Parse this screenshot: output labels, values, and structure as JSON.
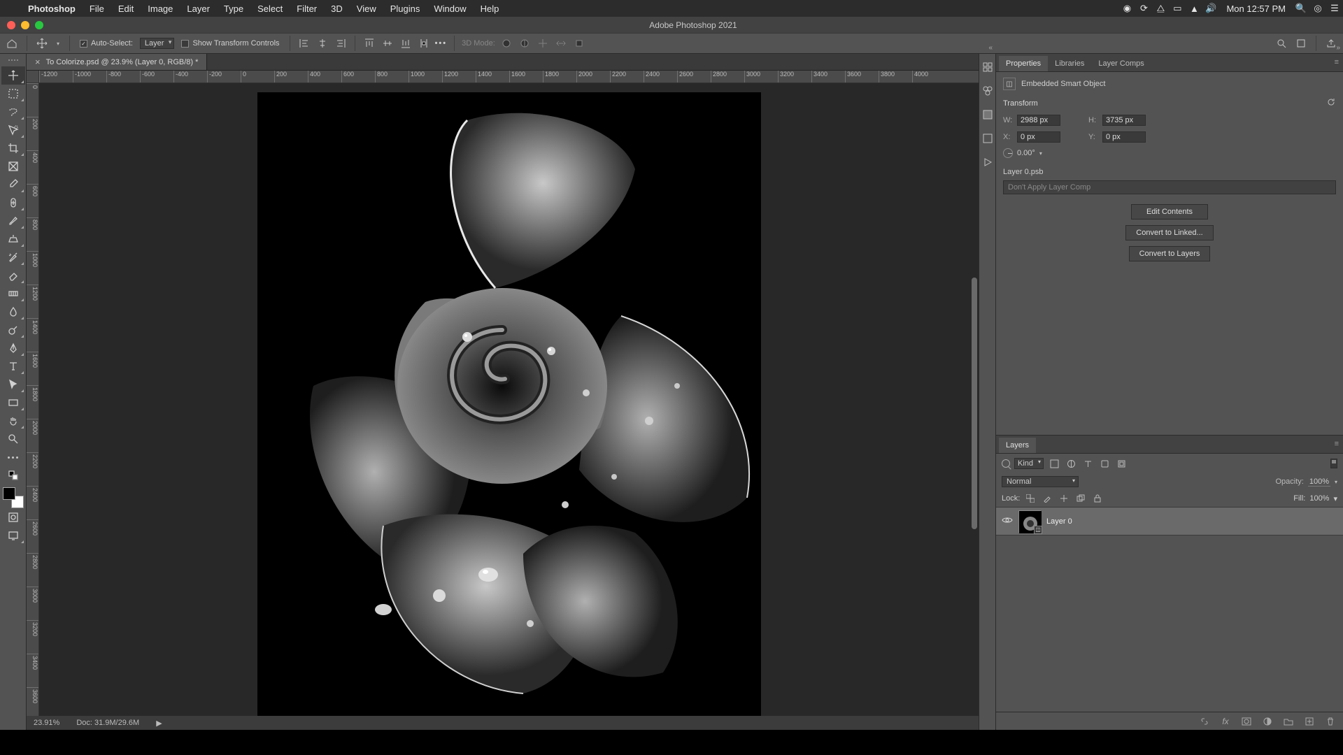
{
  "menubar": {
    "app": "Photoshop",
    "items": [
      "File",
      "Edit",
      "Image",
      "Layer",
      "Type",
      "Select",
      "Filter",
      "3D",
      "View",
      "Plugins",
      "Window",
      "Help"
    ],
    "clock": "Mon 12:57 PM"
  },
  "window": {
    "title": "Adobe Photoshop 2021"
  },
  "options": {
    "auto_select_checked": true,
    "auto_select_label": "Auto-Select:",
    "auto_select_target": "Layer",
    "show_transform_checked": false,
    "show_transform_label": "Show Transform Controls",
    "mode3d_label": "3D Mode:"
  },
  "document": {
    "tab": "To Colorize.psd @ 23.9% (Layer 0, RGB/8) *",
    "zoom": "23.91%",
    "docinfo": "Doc: 31.9M/29.6M",
    "hruler": [
      "-1200",
      "-1000",
      "-800",
      "-600",
      "-400",
      "-200",
      "0",
      "200",
      "400",
      "600",
      "800",
      "1000",
      "1200",
      "1400",
      "1600",
      "1800",
      "2000",
      "2200",
      "2400",
      "2600",
      "2800",
      "3000",
      "3200",
      "3400",
      "3600",
      "3800",
      "4000"
    ],
    "vruler": [
      "0",
      "200",
      "400",
      "600",
      "800",
      "1000",
      "1200",
      "1400",
      "1600",
      "1800",
      "2000",
      "2200",
      "2400",
      "2600",
      "2800",
      "3000",
      "3200",
      "3400",
      "3600"
    ]
  },
  "properties": {
    "tabs": [
      "Properties",
      "Libraries",
      "Layer Comps"
    ],
    "active_tab": 0,
    "type_label": "Embedded Smart Object",
    "transform_label": "Transform",
    "w_label": "W:",
    "w_value": "2988 px",
    "h_label": "H:",
    "h_value": "3735 px",
    "x_label": "X:",
    "x_value": "0 px",
    "y_label": "Y:",
    "y_value": "0 px",
    "angle_value": "0.00°",
    "linked_file": "Layer 0.psb",
    "layer_comp_placeholder": "Don't Apply Layer Comp",
    "btn_edit": "Edit Contents",
    "btn_linked": "Convert to Linked...",
    "btn_layers": "Convert to Layers"
  },
  "layers": {
    "tab": "Layers",
    "kind_label": "Kind",
    "blend_mode": "Normal",
    "opacity_label": "Opacity:",
    "opacity_value": "100%",
    "lock_label": "Lock:",
    "fill_label": "Fill:",
    "fill_value": "100%",
    "layer0_name": "Layer 0"
  }
}
